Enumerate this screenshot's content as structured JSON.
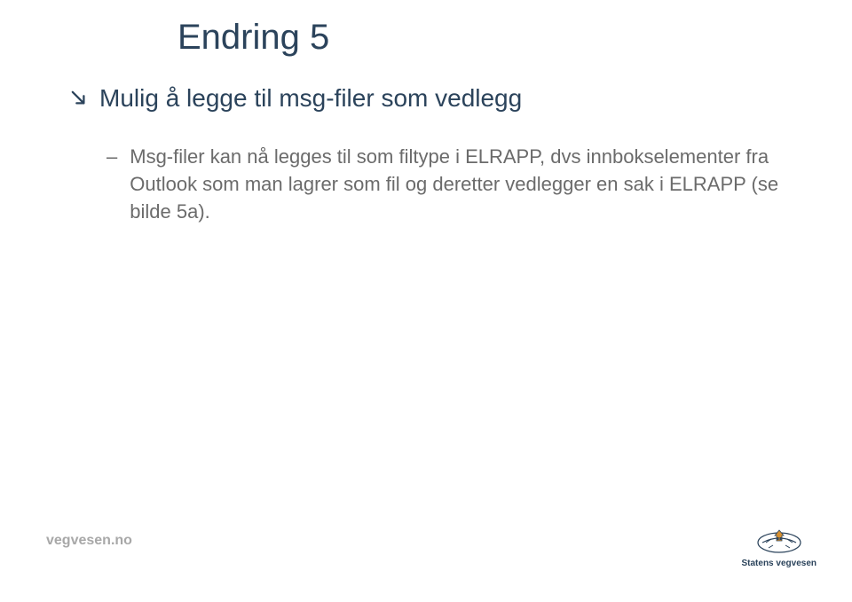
{
  "slide": {
    "title": "Endring 5",
    "main_bullet": "Mulig å legge til msg-filer som vedlegg",
    "sub_bullet": "Msg-filer kan nå legges til som filtype i ELRAPP, dvs innbokselementer fra Outlook som man lagrer som fil og deretter vedlegger en sak i ELRAPP (se bilde 5a)."
  },
  "footer": {
    "left": "vegvesen.no",
    "right": "Statens vegvesen"
  },
  "colors": {
    "primary": "#2b435b",
    "secondary": "#6b6b6b",
    "muted": "#a8a8a8"
  }
}
